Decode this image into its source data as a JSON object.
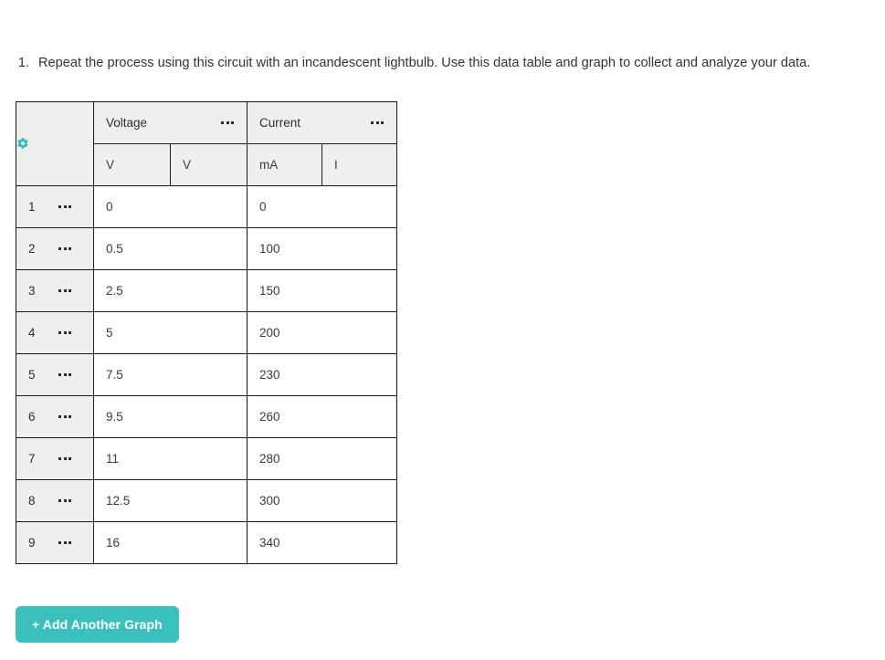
{
  "question": {
    "marker": "1.",
    "text": "Repeat the process using this circuit with an incandescent lightbulb. Use this data table and graph to collect and analyze your data."
  },
  "table": {
    "corner_icon": "gear-icon",
    "group_headers": [
      {
        "label": "Voltage",
        "menu_icon": "dots-icon"
      },
      {
        "label": "Current",
        "menu_icon": "dots-icon"
      }
    ],
    "unit_headers": [
      "V",
      "V",
      "mA",
      "I"
    ],
    "rows": [
      {
        "num": "1",
        "menu_icon": "dots-icon",
        "voltage": "0",
        "current": "0"
      },
      {
        "num": "2",
        "menu_icon": "dots-icon",
        "voltage": "0.5",
        "current": "100"
      },
      {
        "num": "3",
        "menu_icon": "dots-icon",
        "voltage": "2.5",
        "current": "150"
      },
      {
        "num": "4",
        "menu_icon": "dots-icon",
        "voltage": "5",
        "current": "200"
      },
      {
        "num": "5",
        "menu_icon": "dots-icon",
        "voltage": "7.5",
        "current": "230"
      },
      {
        "num": "6",
        "menu_icon": "dots-icon",
        "voltage": "9.5",
        "current": "260"
      },
      {
        "num": "7",
        "menu_icon": "dots-icon",
        "voltage": "11",
        "current": "280"
      },
      {
        "num": "8",
        "menu_icon": "dots-icon",
        "voltage": "12.5",
        "current": "300"
      },
      {
        "num": "9",
        "menu_icon": "dots-icon",
        "voltage": "16",
        "current": "340"
      }
    ]
  },
  "actions": {
    "add_graph_label": "+ Add Another Graph"
  },
  "colors": {
    "accent_teal": "#3bc0be",
    "gear_teal": "#2ebdbd",
    "header_gray": "#efefef",
    "border_dark": "#1a1a1a",
    "text_dark": "#333333"
  }
}
